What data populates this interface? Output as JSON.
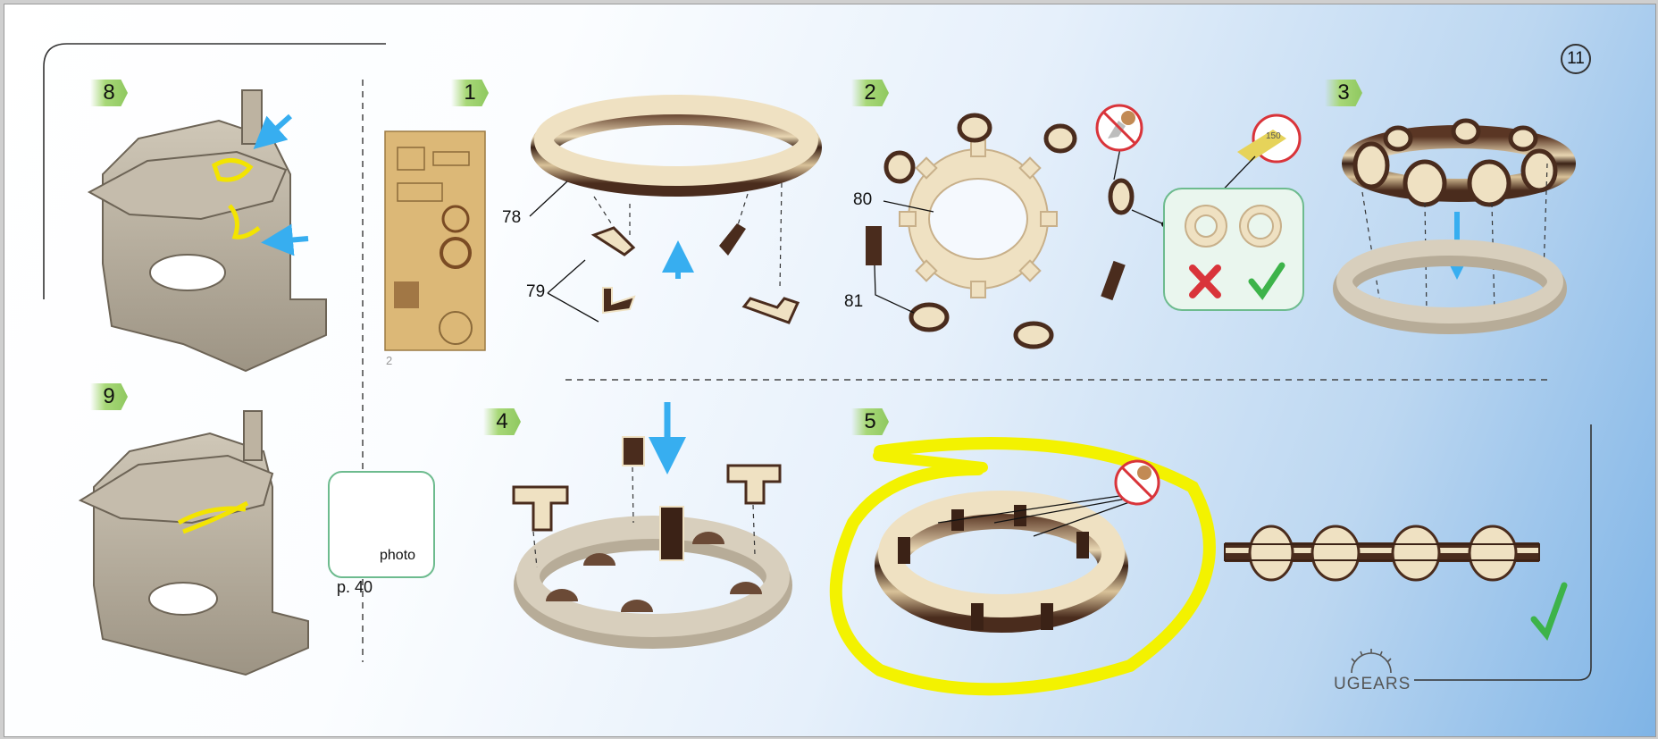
{
  "page_number": "11",
  "steps": [
    {
      "id": "8",
      "label": "8"
    },
    {
      "id": "9",
      "label": "9"
    },
    {
      "id": "1",
      "label": "1"
    },
    {
      "id": "2",
      "label": "2"
    },
    {
      "id": "3",
      "label": "3"
    },
    {
      "id": "4",
      "label": "4"
    },
    {
      "id": "5",
      "label": "5"
    }
  ],
  "part_numbers": {
    "p78": "78",
    "p79": "79",
    "p80": "80",
    "p81": "81"
  },
  "sheet_number": "2",
  "photo_label": "photo",
  "page_reference": "p. 40",
  "brand": "UGEARS",
  "sandpaper_grit": "150",
  "colors": {
    "badge_green": "#8fc860",
    "arrow_blue": "#37aef0",
    "highlight_yellow": "#f3f200",
    "check_green": "#3db34a",
    "cross_red": "#d9343a",
    "prohibit_red": "#d9343a",
    "wood_light": "#efe1c2",
    "wood_dark": "#4a2c1d"
  },
  "icons": [
    "arrow-down-icon",
    "arrow-up-icon",
    "check-icon",
    "cross-icon",
    "no-glue-icon",
    "sandpaper-icon",
    "ugears-gear-logo-icon"
  ]
}
